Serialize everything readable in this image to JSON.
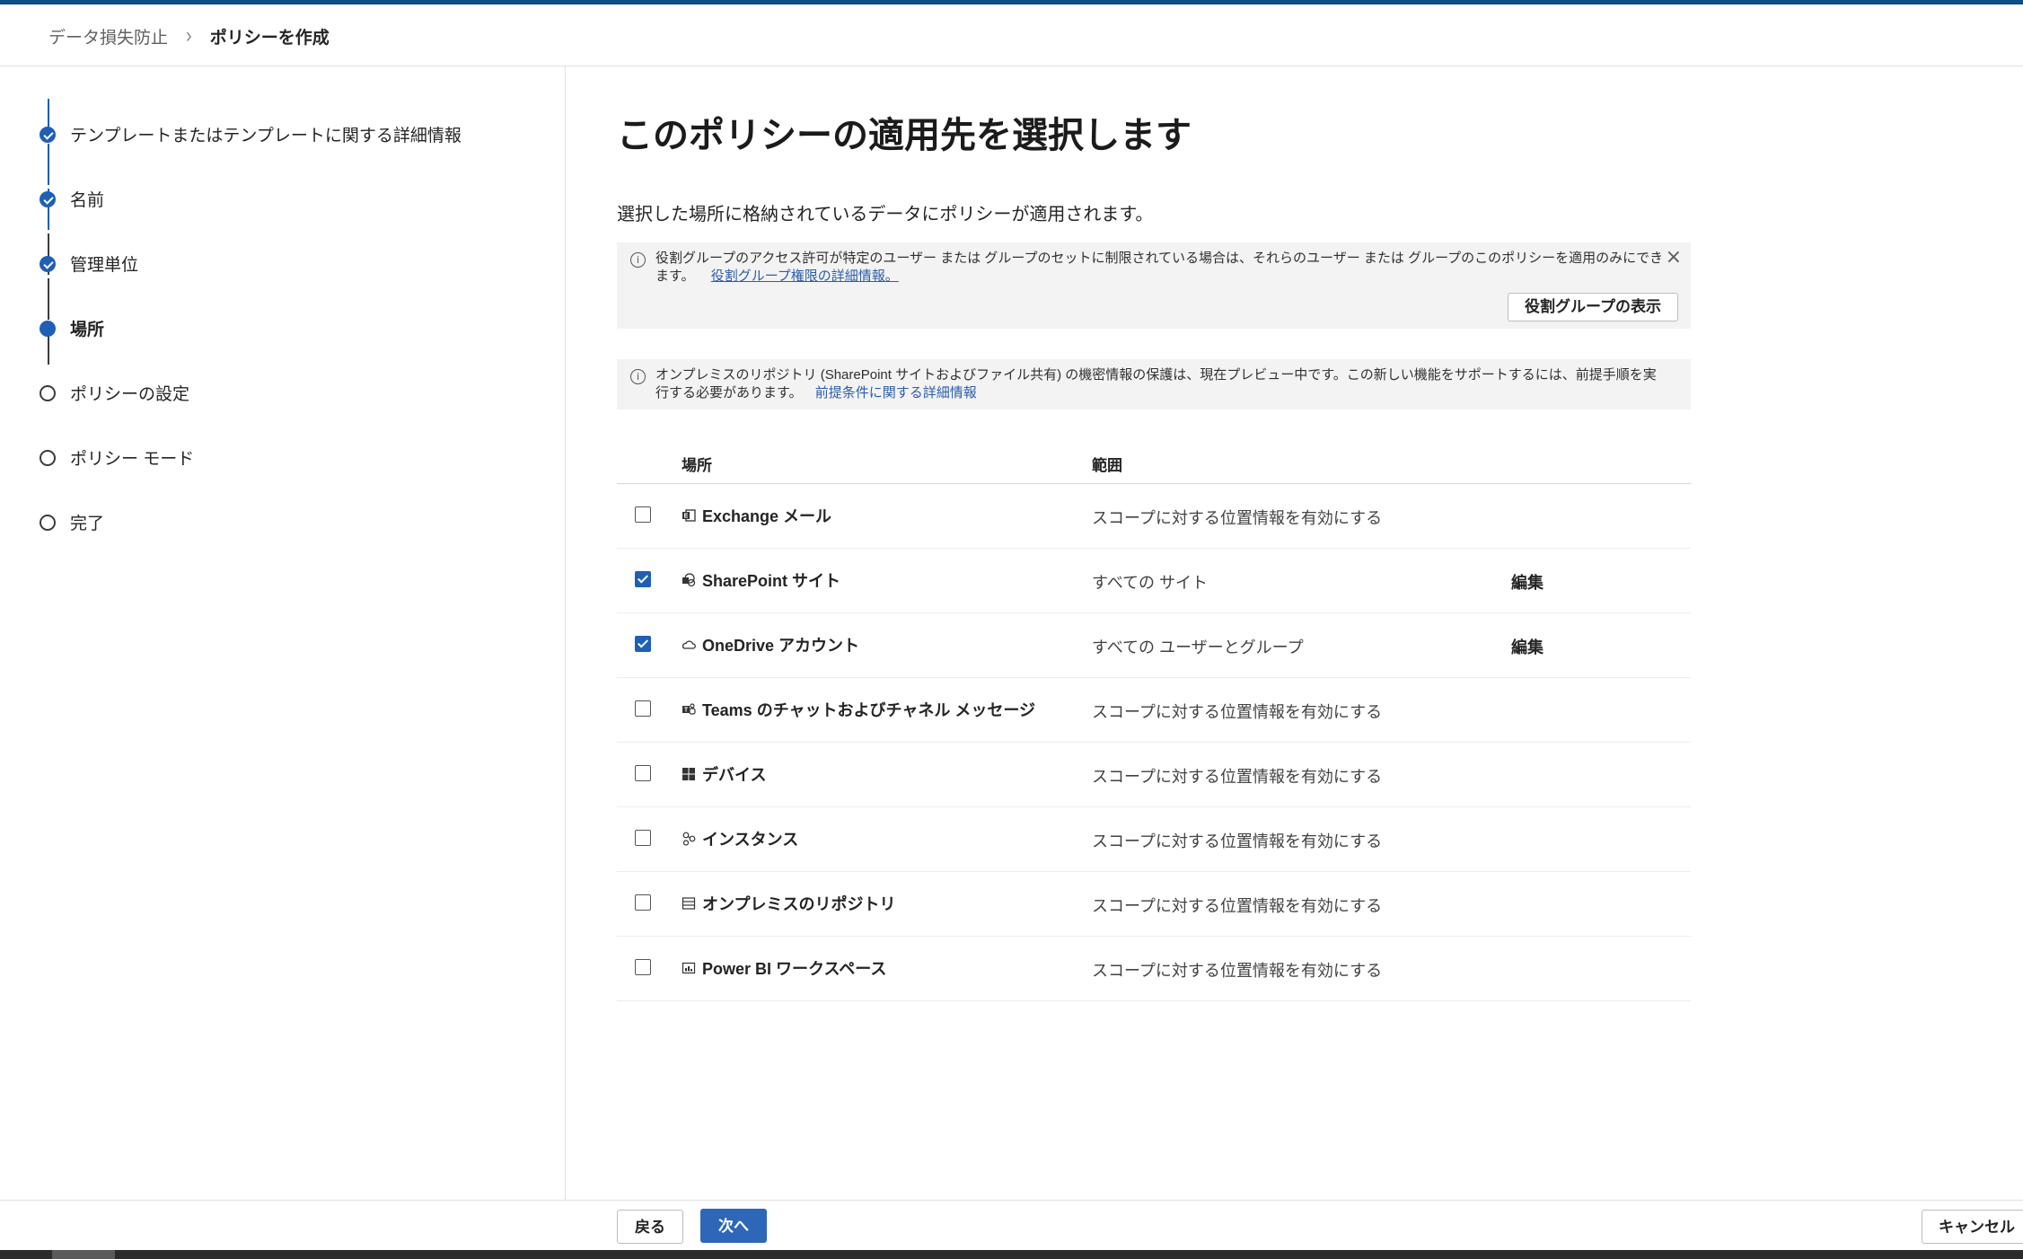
{
  "breadcrumb": {
    "parent": "データ損失防止",
    "current": "ポリシーを作成"
  },
  "steps": [
    {
      "label": "テンプレートまたはテンプレートに関する詳細情報",
      "state": "done"
    },
    {
      "label": "名前",
      "state": "done"
    },
    {
      "label": "管理単位",
      "state": "done"
    },
    {
      "label": "場所",
      "state": "current"
    },
    {
      "label": "ポリシーの設定",
      "state": "todo"
    },
    {
      "label": "ポリシー モード",
      "state": "todo"
    },
    {
      "label": "完了",
      "state": "todo"
    }
  ],
  "main": {
    "title": "このポリシーの適用先を選択します",
    "description": "選択した場所に格納されているデータにポリシーが適用されます。"
  },
  "info1": {
    "text": "役割グループのアクセス許可が特定のユーザー または グループのセットに制限されている場合は、それらのユーザー または グループのこのポリシーを適用のみにできます。",
    "link": "役割グループ権限の詳細情報。",
    "button": "役割グループの表示"
  },
  "info2": {
    "text": "オンプレミスのリポジトリ (SharePoint サイトおよびファイル共有) の機密情報の保護は、現在プレビュー中です。この新しい機能をサポートするには、前提手順を実行する必要があります。",
    "link": "前提条件に関する詳細情報"
  },
  "table": {
    "headers": {
      "location": "場所",
      "scope": "範囲"
    },
    "rows": [
      {
        "name": "Exchange メール",
        "scope": "スコープに対する位置情報を有効にする",
        "checked": false,
        "edit": "",
        "icon": "exchange-icon"
      },
      {
        "name": "SharePoint サイト",
        "scope": "すべての サイト",
        "checked": true,
        "edit": "編集",
        "icon": "sharepoint-icon"
      },
      {
        "name": "OneDrive アカウント",
        "scope": "すべての ユーザーとグループ",
        "checked": true,
        "edit": "編集",
        "icon": "onedrive-icon"
      },
      {
        "name": "Teams のチャットおよびチャネル メッセージ",
        "scope": "スコープに対する位置情報を有効にする",
        "checked": false,
        "edit": "",
        "icon": "teams-icon"
      },
      {
        "name": "デバイス",
        "scope": "スコープに対する位置情報を有効にする",
        "checked": false,
        "edit": "",
        "icon": "windows-icon"
      },
      {
        "name": "インスタンス",
        "scope": "スコープに対する位置情報を有効にする",
        "checked": false,
        "edit": "",
        "icon": "instances-icon"
      },
      {
        "name": "オンプレミスのリポジトリ",
        "scope": "スコープに対する位置情報を有効にする",
        "checked": false,
        "edit": "",
        "icon": "repository-icon"
      },
      {
        "name": "Power BI ワークスペース",
        "scope": "スコープに対する位置情報を有効にする",
        "checked": false,
        "edit": "",
        "icon": "powerbi-icon"
      }
    ]
  },
  "footer": {
    "back": "戻る",
    "next": "次へ",
    "cancel": "キャンセル"
  },
  "colors": {
    "accent": "#1f5fb5",
    "topbar": "#0f4c8a",
    "primary_button": "#2e67b8"
  }
}
